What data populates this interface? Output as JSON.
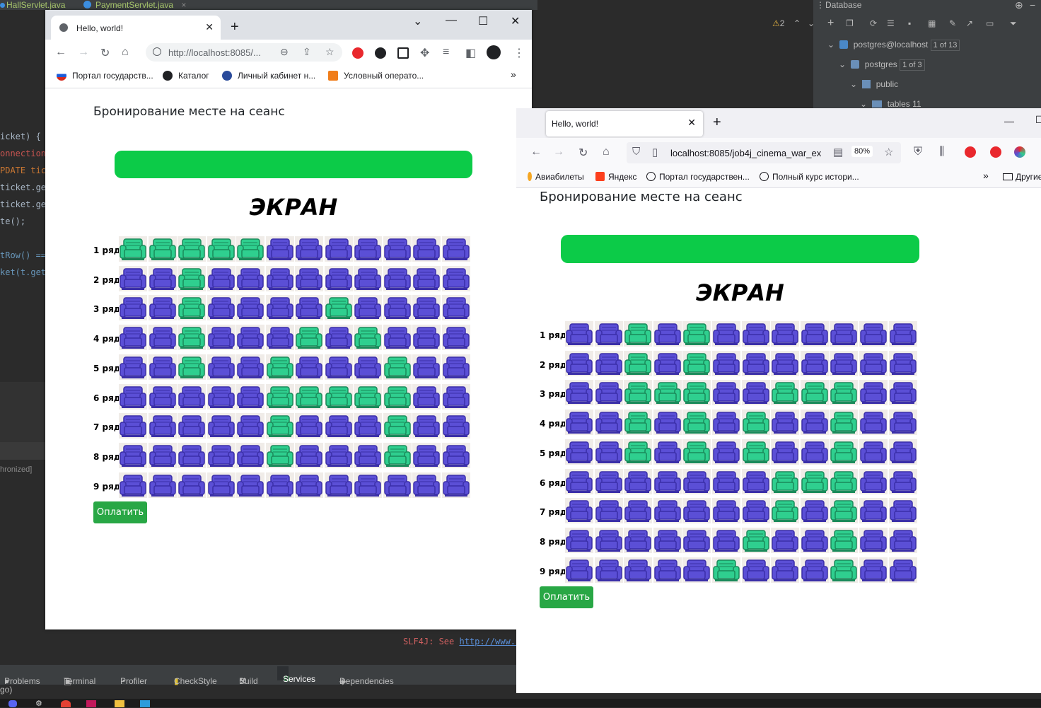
{
  "ide": {
    "tabs": [
      "HallServlet.java",
      "PaymentServlet.java"
    ],
    "code_lines": [
      {
        "text": "icket) {",
        "color": "#a9b7c6"
      },
      {
        "text": "onnection",
        "color": "#c75450"
      },
      {
        "text": "PDATE tic",
        "color": "#cc7832"
      },
      {
        "text": "ticket.ge",
        "color": "#a9b7c6"
      },
      {
        "text": "ticket.ge",
        "color": "#a9b7c6"
      },
      {
        "text": "te();",
        "color": "#a9b7c6"
      },
      {
        "text": "tRow() ==",
        "color": "#6897bb"
      },
      {
        "text": "ket(t.get",
        "color": "#6897bb"
      }
    ],
    "synchronized_text": "hronized]",
    "go_text": "go)",
    "console": {
      "prefix": "SLF4J: See ",
      "link": "http://www.s"
    },
    "bottom_tabs": [
      "Problems",
      "Terminal",
      "Profiler",
      "CheckStyle",
      "Build",
      "Services",
      "Dependencies"
    ],
    "db": {
      "title": "Database",
      "warnings": "2",
      "tree": [
        {
          "label": "postgres@localhost",
          "badge": "1 of 13"
        },
        {
          "label": "postgres",
          "badge": "1 of 3"
        },
        {
          "label": "public",
          "badge": ""
        },
        {
          "label": "tables 11",
          "badge": ""
        }
      ]
    }
  },
  "chrome": {
    "tab_title": "Hello, world!",
    "url": "http://localhost:8085/...",
    "bookmarks": [
      "Портал государств...",
      "Каталог",
      "Личный кабинет н...",
      "Условный операто..."
    ],
    "page": {
      "title": "Бронирование месте на сеанс",
      "screen": "ЭКРАН",
      "pay": "Оплатить",
      "rows": [
        {
          "label": "1 ряд",
          "occupied": [
            1,
            2,
            3,
            4,
            5
          ]
        },
        {
          "label": "2 ряд",
          "occupied": [
            3
          ]
        },
        {
          "label": "3 ряд",
          "occupied": [
            3,
            8
          ]
        },
        {
          "label": "4 ряд",
          "occupied": [
            3,
            7,
            9
          ]
        },
        {
          "label": "5 ряд",
          "occupied": [
            3,
            6,
            10
          ]
        },
        {
          "label": "6 ряд",
          "occupied": [
            6,
            7,
            8,
            9,
            10
          ]
        },
        {
          "label": "7 ряд",
          "occupied": [
            6,
            10
          ]
        },
        {
          "label": "8 ряд",
          "occupied": [
            6,
            10
          ]
        },
        {
          "label": "9 ряд",
          "occupied": []
        }
      ]
    }
  },
  "firefox": {
    "tab_title": "Hello, world!",
    "url": "localhost:8085/job4j_cinema_war_ex",
    "zoom": "80%",
    "bookmarks": [
      "Авиабилеты",
      "Яндекс",
      "Портал государствен...",
      "Полный курс истори...",
      "Другие"
    ],
    "page": {
      "title": "Бронирование месте на сеанс",
      "screen": "ЭКРАН",
      "pay": "Оплатить",
      "rows": [
        {
          "label": "1 ряд",
          "occupied": [
            3,
            5
          ]
        },
        {
          "label": "2 ряд",
          "occupied": [
            3,
            5
          ]
        },
        {
          "label": "3 ряд",
          "occupied": [
            3,
            4,
            5,
            8,
            9,
            10
          ]
        },
        {
          "label": "4 ряд",
          "occupied": [
            3,
            5,
            7,
            10
          ]
        },
        {
          "label": "5 ряд",
          "occupied": [
            3,
            5,
            7,
            10
          ]
        },
        {
          "label": "6 ряд",
          "occupied": [
            8,
            9,
            10
          ]
        },
        {
          "label": "7 ряд",
          "occupied": [
            8,
            10
          ]
        },
        {
          "label": "8 ряд",
          "occupied": [
            7,
            10
          ]
        },
        {
          "label": "9 ряд",
          "occupied": [
            6,
            10
          ]
        }
      ]
    }
  },
  "colors": {
    "seat_free": "#5b4fd6",
    "seat_free_dark": "#3b2fa8",
    "seat_taken": "#2fcf8f",
    "seat_taken_dark": "#1a8a5a",
    "green_bar": "#0ccb48",
    "pay_button": "#28a745"
  }
}
